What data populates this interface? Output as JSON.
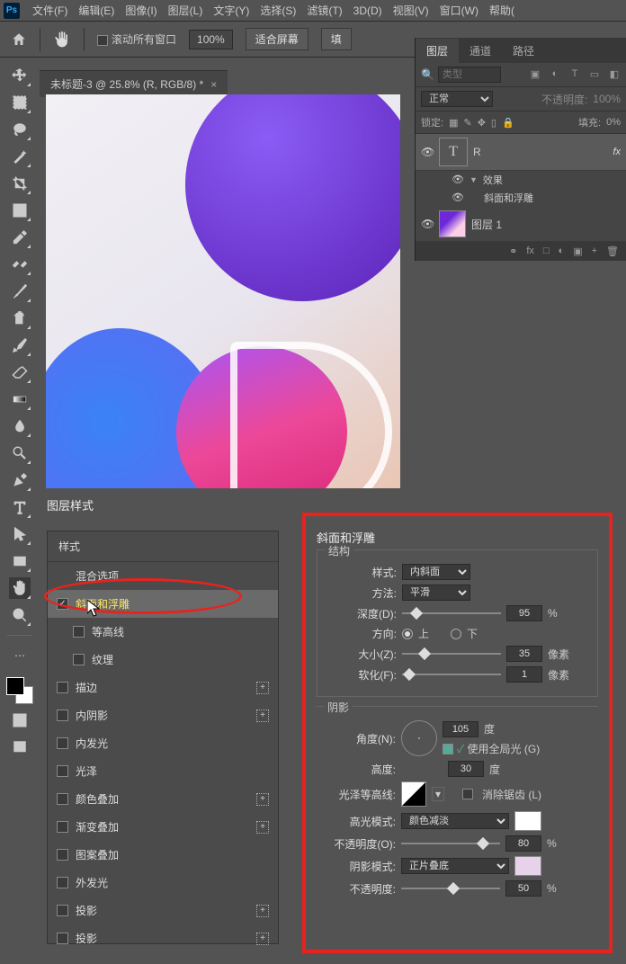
{
  "menubar": {
    "items": [
      "文件(F)",
      "编辑(E)",
      "图像(I)",
      "图层(L)",
      "文字(Y)",
      "选择(S)",
      "滤镜(T)",
      "3D(D)",
      "视图(V)",
      "窗口(W)",
      "帮助("
    ]
  },
  "optbar": {
    "scroll_all": "滚动所有窗口",
    "zoom": "100%",
    "fit": "适合屏幕",
    "fill_partial": "填"
  },
  "doc": {
    "title": "未标题-3 @ 25.8% (R, RGB/8) *",
    "close": "×"
  },
  "panels": {
    "tabs": [
      "图层",
      "通道",
      "路径"
    ],
    "search_placeholder": "类型",
    "blend": "正常",
    "opacity_lbl": "不透明度:",
    "opacity_val": "100%",
    "lock": "锁定:",
    "fill_lbl": "填充:",
    "fill_val": "0%",
    "layer_r": "R",
    "fx": "fx",
    "effects": "效果",
    "bevel": "斜面和浮雕",
    "layer1": "图层 1",
    "footer": [
      "fx",
      "□",
      "◐",
      "▣",
      "+",
      "🗑"
    ]
  },
  "dialog": {
    "title": "图层样式"
  },
  "styles": {
    "head": "样式",
    "blend": "混合选项",
    "items": [
      {
        "k": "bevel",
        "label": "斜面和浮雕",
        "on": true,
        "sel": true
      },
      {
        "k": "contour",
        "label": "等高线",
        "on": false,
        "indent": true
      },
      {
        "k": "texture",
        "label": "纹理",
        "on": false,
        "indent": true
      },
      {
        "k": "stroke",
        "label": "描边",
        "on": false,
        "plus": true
      },
      {
        "k": "inner_shadow",
        "label": "内阴影",
        "on": false,
        "plus": true
      },
      {
        "k": "inner_glow",
        "label": "内发光",
        "on": false
      },
      {
        "k": "satin",
        "label": "光泽",
        "on": false
      },
      {
        "k": "color_overlay",
        "label": "颜色叠加",
        "on": false,
        "plus": true
      },
      {
        "k": "grad_overlay",
        "label": "渐变叠加",
        "on": false,
        "plus": true
      },
      {
        "k": "pat_overlay",
        "label": "图案叠加",
        "on": false
      },
      {
        "k": "outer_glow",
        "label": "外发光",
        "on": false
      },
      {
        "k": "drop1",
        "label": "投影",
        "on": false,
        "plus": true
      },
      {
        "k": "drop2",
        "label": "投影",
        "on": false,
        "plus": true
      }
    ]
  },
  "bevel": {
    "title": "斜面和浮雕",
    "struct": "结构",
    "style_lbl": "样式:",
    "style_val": "内斜面",
    "tech_lbl": "方法:",
    "tech_val": "平滑",
    "depth_lbl": "深度(D):",
    "depth_val": "95",
    "pct": "%",
    "dir_lbl": "方向:",
    "up": "上",
    "down": "下",
    "size_lbl": "大小(Z):",
    "size_val": "35",
    "px": "像素",
    "soften_lbl": "软化(F):",
    "soften_val": "1",
    "shading": "阴影",
    "angle_lbl": "角度(N):",
    "angle_val": "105",
    "deg": "度",
    "global": "使用全局光 (G)",
    "alt_lbl": "高度:",
    "alt_val": "30",
    "gloss_lbl": "光泽等高线:",
    "aa": "消除锯齿 (L)",
    "hi_lbl": "高光模式:",
    "hi_val": "颜色减淡",
    "hi_color": "#ffffff",
    "hi_op_lbl": "不透明度(O):",
    "hi_op_val": "80",
    "sh_lbl": "阴影模式:",
    "sh_val": "正片叠底",
    "sh_color": "#e6d3ea",
    "sh_op_lbl": "不透明度:",
    "sh_op_val": "50"
  }
}
